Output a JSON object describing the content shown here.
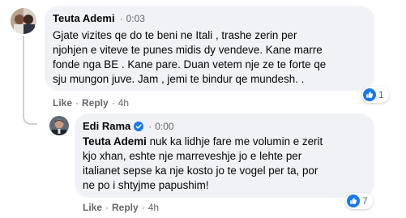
{
  "comments": [
    {
      "author": "Teuta Ademi",
      "separator": "·",
      "time": "0:03",
      "text": "Gjate vizites qe do te beni ne Itali , trashe zerin per\nnjohjen e viteve te punes midis dy vendeve. Kane marre\nfonde nga BE . Kane pare. Duan vetem nje ze te forte qe\nsju mungon juve. Jam , jemi te bindur qe mundesh. .",
      "actions": {
        "like": "Like",
        "reply": "Reply",
        "dot": "·",
        "age": "4h"
      },
      "reactions": {
        "icon": "like-reaction-icon",
        "count": "1"
      }
    },
    {
      "author": "Edi Rama",
      "verified": true,
      "separator": "·",
      "time": "0:00",
      "mention": "Teuta Ademi",
      "text_after_mention": " nuk ka lidhje fare me volumin e zerit\nkjo xhan, eshte nje marreveshje jo e lehte per\nitalianet sepse ka nje kosto jo te vogel per ta, por\nne po i shtyjme papushim!",
      "actions": {
        "like": "Like",
        "reply": "Reply",
        "dot": "·",
        "age": "4h"
      },
      "reactions": {
        "icon": "like-reaction-icon",
        "count": "7"
      }
    }
  ],
  "colors": {
    "bubble": "#f0f2f5",
    "like_blue": "#1877f2",
    "meta_gray": "#65676b",
    "thread_line": "#ced0d4"
  }
}
